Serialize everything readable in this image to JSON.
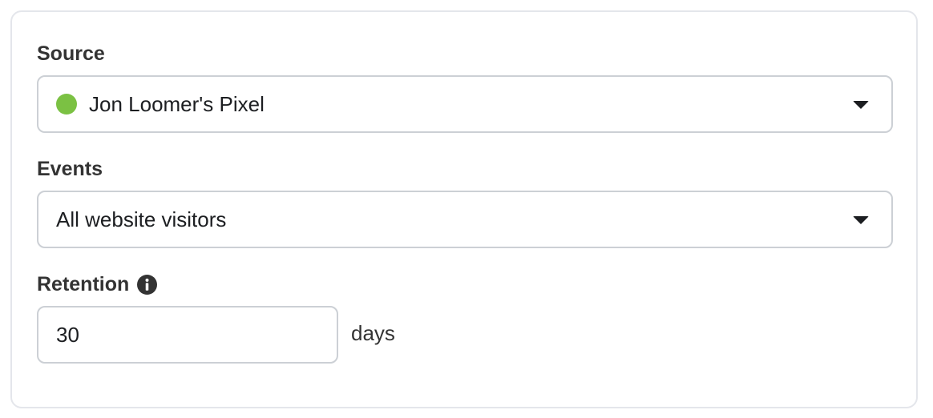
{
  "source": {
    "label": "Source",
    "selected_value": "Jon Loomer's Pixel",
    "status_color": "#7bc143",
    "icon": "chevron-down-icon"
  },
  "events": {
    "label": "Events",
    "selected_value": "All website visitors",
    "icon": "chevron-down-icon"
  },
  "retention": {
    "label": "Retention",
    "info_icon": "info-icon",
    "value": "30",
    "suffix": "days"
  }
}
